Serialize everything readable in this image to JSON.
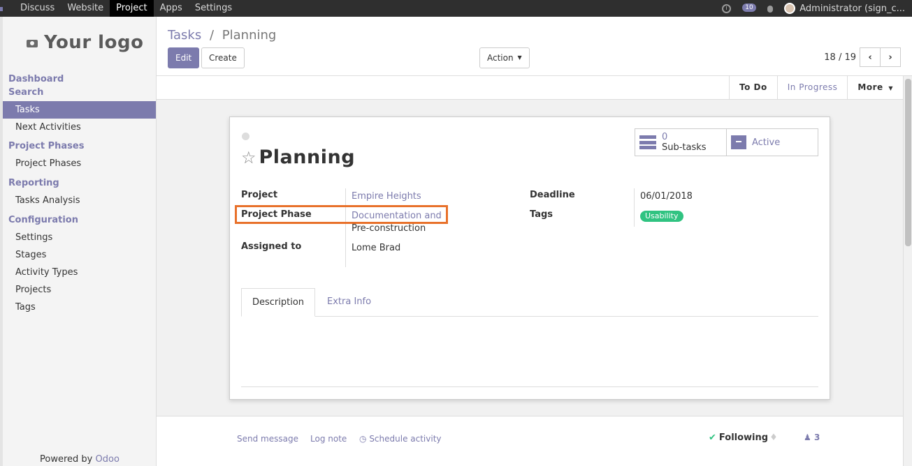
{
  "topnav": {
    "items": [
      "Discuss",
      "Website",
      "Project",
      "Apps",
      "Settings"
    ],
    "active": "Project",
    "chat_count": "10",
    "user": "Administrator (sign_c..."
  },
  "sidebar": {
    "logo_text": "Your logo",
    "sections": [
      {
        "title": "Dashboard"
      },
      {
        "title": "Search",
        "items": [
          "Tasks",
          "Next Activities"
        ]
      },
      {
        "title": "Project Phases",
        "items": [
          "Project Phases"
        ]
      },
      {
        "title": "Reporting",
        "items": [
          "Tasks Analysis"
        ]
      },
      {
        "title": "Configuration",
        "items": [
          "Settings",
          "Stages",
          "Activity Types",
          "Projects",
          "Tags"
        ]
      }
    ],
    "active_item": "Tasks",
    "powered_by": "Powered by",
    "powered_brand": "Odoo"
  },
  "control": {
    "breadcrumb_root": "Tasks",
    "breadcrumb_sep": "/",
    "breadcrumb_current": "Planning",
    "edit_label": "Edit",
    "create_label": "Create",
    "action_label": "Action",
    "pager_value": "18 / 19"
  },
  "statusbar": {
    "stages": [
      "To Do",
      "In Progress"
    ],
    "more_label": "More"
  },
  "form": {
    "title": "Planning",
    "subtasks_count": "0",
    "subtasks_label": "Sub-tasks",
    "active_label": "Active",
    "fields": {
      "project_label": "Project",
      "project_value": "Empire Heights",
      "phase_label": "Project Phase",
      "phase_value_line1": "Documentation and",
      "phase_value_line2": "Pre-construction",
      "assigned_label": "Assigned to",
      "assigned_value": "Lome Brad",
      "deadline_label": "Deadline",
      "deadline_value": "06/01/2018",
      "tags_label": "Tags",
      "tag_value": "Usability"
    },
    "tabs": [
      "Description",
      "Extra Info"
    ]
  },
  "chatter": {
    "send_message": "Send message",
    "log_note": "Log note",
    "schedule_activity": "Schedule activity",
    "following": "Following",
    "followers_count": "3"
  },
  "colors": {
    "brand": "#7c7bad",
    "highlight": "#e8712b",
    "tag": "#30c381"
  }
}
